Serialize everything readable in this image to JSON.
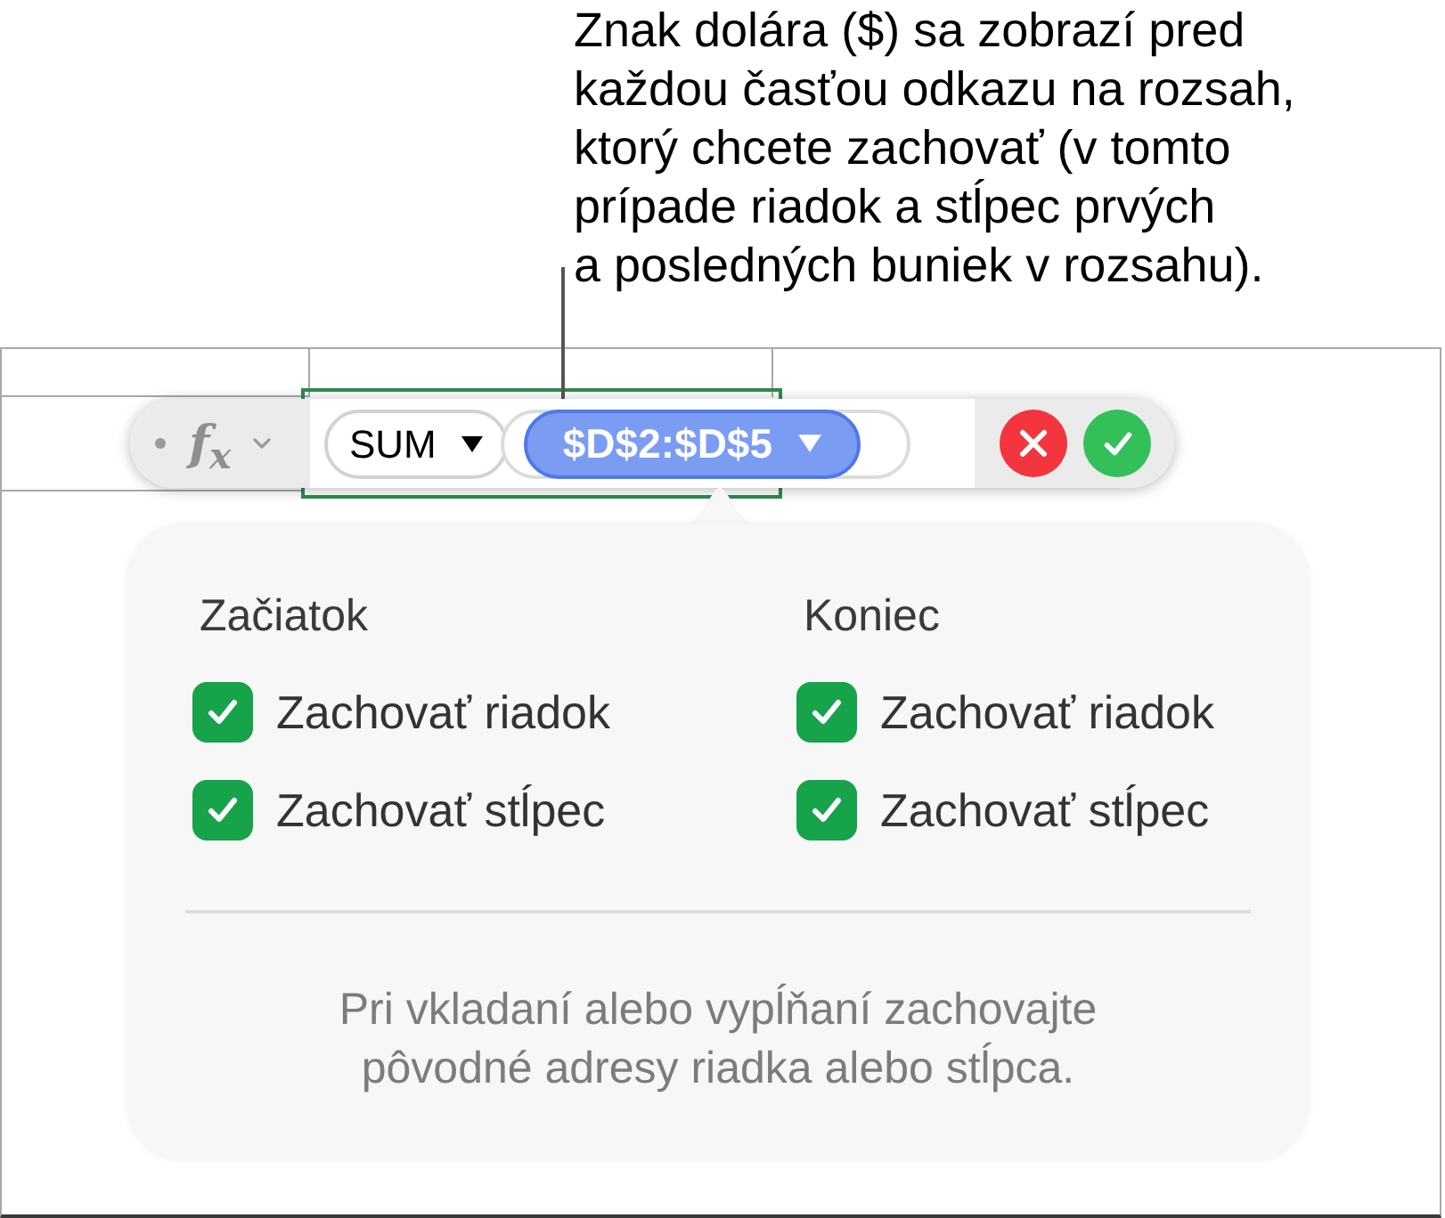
{
  "callout": {
    "lines": [
      "Znak dolára ($) sa zobrazí pred",
      "každou časťou odkazu na rozsah,",
      "ktorý chcete zachovať (v tomto",
      "prípade riadok a stĺpec prvých",
      "a posledných buniek v rozsahu)."
    ]
  },
  "formula_bar": {
    "function_label": "f$_{x}$",
    "tokens": [
      {
        "kind": "function",
        "label": "SUM",
        "selected": false
      },
      {
        "kind": "range",
        "label": "$D$2:$D$5",
        "selected": true
      }
    ]
  },
  "popover": {
    "groups": [
      {
        "heading": "Začiatok",
        "options": [
          {
            "label": "Zachovať riadok",
            "checked": true
          },
          {
            "label": "Zachovať stĺpec",
            "checked": true
          }
        ]
      },
      {
        "heading": "Koniec",
        "options": [
          {
            "label": "Zachovať riadok",
            "checked": true
          },
          {
            "label": "Zachovať stĺpec",
            "checked": true
          }
        ]
      }
    ],
    "note": {
      "lines": [
        "Pri vkladaní alebo vypĺňaní zachovajte",
        "pôvodné adresy riadka alebo stĺpca."
      ]
    }
  }
}
